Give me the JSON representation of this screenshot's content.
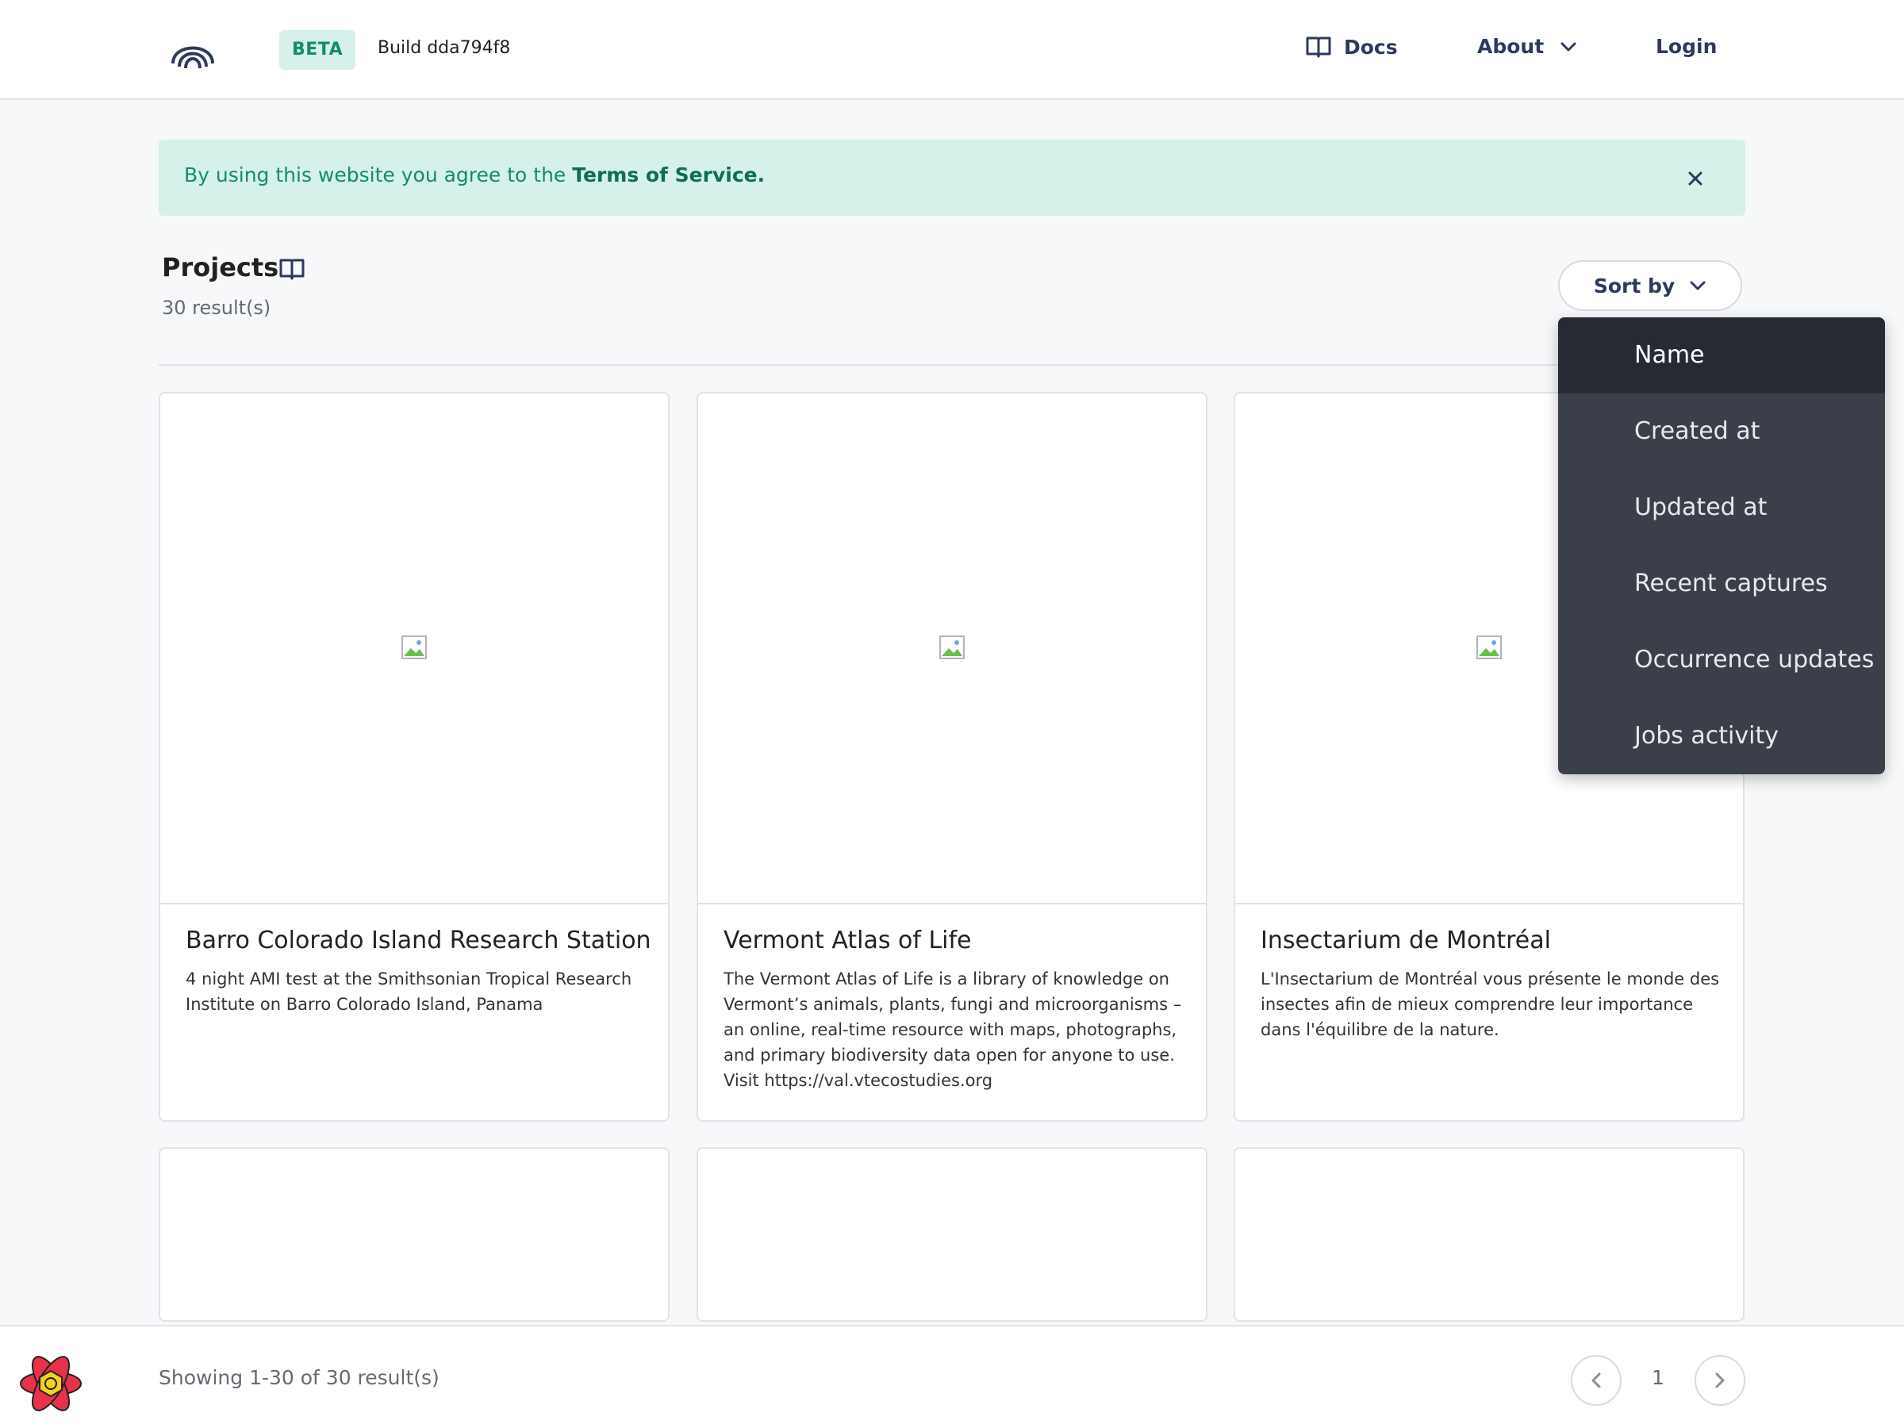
{
  "header": {
    "badge": "BETA",
    "build": "Build dda794f8",
    "nav": {
      "docs": "Docs",
      "about": "About",
      "login": "Login"
    }
  },
  "banner": {
    "text": "By using this website you agree to the ",
    "link": "Terms of Service."
  },
  "projects": {
    "title": "Projects",
    "count": "30 result(s)",
    "sort_label": "Sort by"
  },
  "sort_menu": {
    "selected": "Name",
    "options": [
      "Name",
      "Created at",
      "Updated at",
      "Recent captures",
      "Occurrence updates",
      "Jobs activity"
    ]
  },
  "cards": [
    {
      "title": "Barro Colorado Island Research Station",
      "description": "4 night AMI test at the Smithsonian Tropical Research Institute on Barro Colorado Island, Panama"
    },
    {
      "title": "Vermont Atlas of Life",
      "description": "The Vermont Atlas of Life is a library of knowledge on Vermont’s animals, plants, fungi and microorganisms – an online, real-time resource with maps, photographs, and primary biodiversity data open for anyone to use. Visit https://val.vtecostudies.org"
    },
    {
      "title": "Insectarium de Montréal",
      "description": "L'Insectarium de Montréal vous présente le monde des insectes afin de mieux comprendre leur importance dans l'équilibre de la nature."
    }
  ],
  "footer": {
    "showing": "Showing 1-30 of 30 result(s)",
    "page": "1"
  },
  "colors": {
    "accent": "#168a6c",
    "banner_bg": "#d6f1ea",
    "nav_text": "#2d3a5c",
    "dropdown_bg": "#3a3f4a",
    "dropdown_active": "#262a32"
  },
  "icons": {
    "logo": "rainbow-arches-icon",
    "docs": "open-book-icon",
    "about_chevron": "chevron-down-icon",
    "close": "close-icon",
    "broken_image": "broken-image-icon",
    "footer_logo": "react-atom-icon",
    "prev": "chevron-left-icon",
    "next": "chevron-right-icon"
  }
}
